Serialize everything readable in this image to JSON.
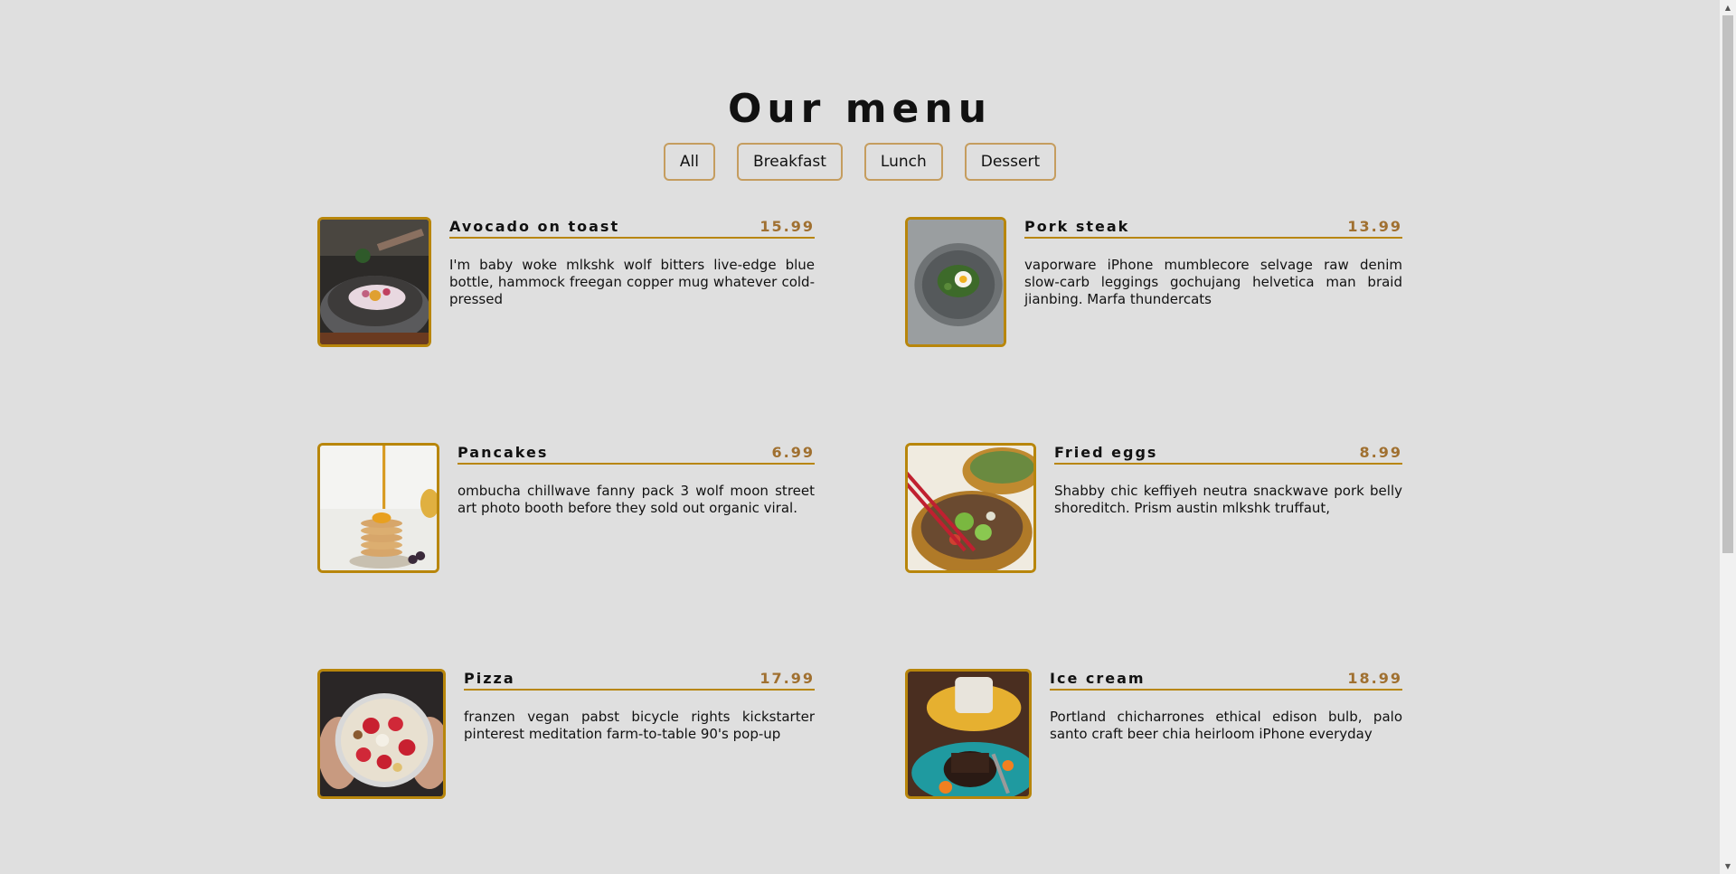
{
  "title": "Our menu",
  "filters": [
    "All",
    "Breakfast",
    "Lunch",
    "Dessert"
  ],
  "items": [
    {
      "name": "Avocado on toast",
      "price": "15.99",
      "desc": "I'm baby woke mlkshk wolf bitters live-edge blue bottle, hammock freegan copper mug whatever cold-pressed"
    },
    {
      "name": "Pork steak",
      "price": "13.99",
      "desc": "vaporware iPhone mumblecore selvage raw denim slow-carb leggings gochujang helvetica man braid jianbing. Marfa thundercats"
    },
    {
      "name": "Pancakes",
      "price": "6.99",
      "desc": "ombucha chillwave fanny pack 3 wolf moon street art photo booth before they sold out organic viral."
    },
    {
      "name": "Fried eggs",
      "price": "8.99",
      "desc": "Shabby chic keffiyeh neutra snackwave pork belly shoreditch. Prism austin mlkshk truffaut,"
    },
    {
      "name": "Pizza",
      "price": "17.99",
      "desc": "franzen vegan pabst bicycle rights kickstarter pinterest meditation farm-to-table 90's pop-up"
    },
    {
      "name": "Ice cream",
      "price": "18.99",
      "desc": "Portland chicharrones ethical edison bulb, palo santo craft beer chia heirloom iPhone everyday"
    }
  ]
}
